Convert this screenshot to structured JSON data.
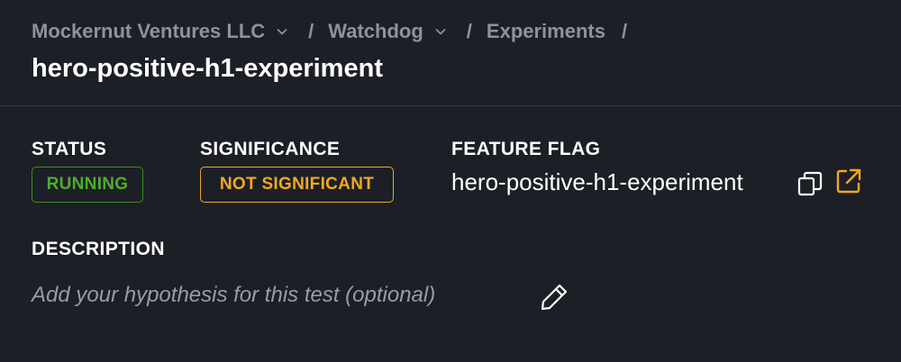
{
  "breadcrumb": {
    "org": "Mockernut Ventures LLC",
    "project": "Watchdog",
    "section": "Experiments",
    "separator": "/"
  },
  "page_title": "hero-positive-h1-experiment",
  "status": {
    "label": "STATUS",
    "value": "RUNNING",
    "color": "#4caf2a"
  },
  "significance": {
    "label": "SIGNIFICANCE",
    "value": "NOT SIGNIFICANT",
    "color": "#f0a91e"
  },
  "feature_flag": {
    "label": "FEATURE FLAG",
    "value": "hero-positive-h1-experiment",
    "icons": [
      "copy-icon",
      "external-link-icon"
    ],
    "link_color": "#f0a91e"
  },
  "description": {
    "label": "DESCRIPTION",
    "placeholder": "Add your hypothesis for this test (optional)",
    "icon": "pencil-icon"
  },
  "colors": {
    "background": "#1d1f27",
    "muted": "#8f929b",
    "divider": "#3a3d46"
  }
}
